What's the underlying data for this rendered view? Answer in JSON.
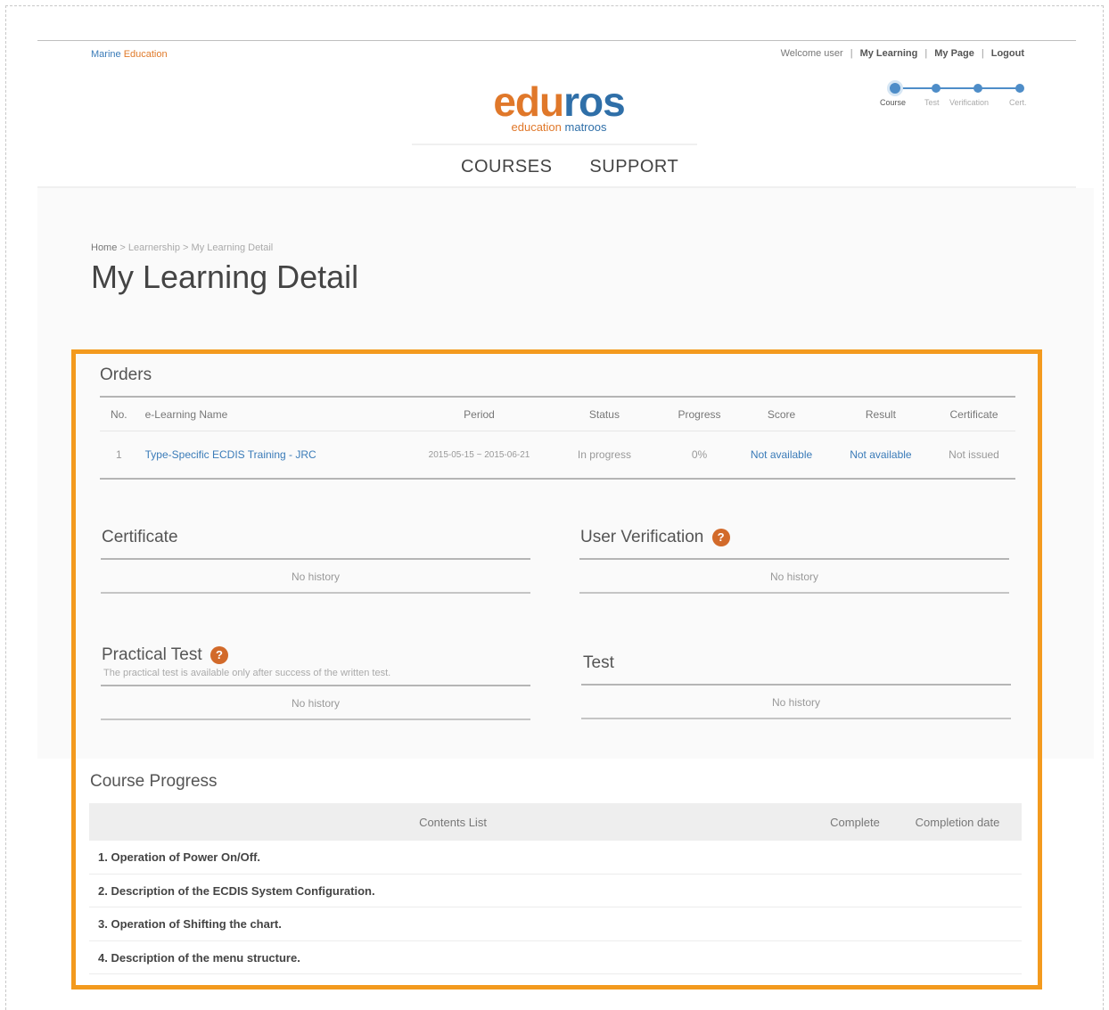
{
  "header": {
    "brand_link_part1": "Marine",
    "brand_link_part2": "Education",
    "topnav": {
      "welcome": "Welcome user",
      "my_learning": "My Learning",
      "my_page": "My Page",
      "logout": "Logout",
      "separator": "|"
    },
    "logo": {
      "main_part1": "edu",
      "main_part2": "ros",
      "sub_part1": "education",
      "sub_part2": "matroos"
    },
    "nav": {
      "courses": "COURSES",
      "support": "SUPPORT"
    },
    "steps": [
      "Course",
      "Test",
      "Verification",
      "Cert."
    ],
    "accent_orange": "#e0782a",
    "accent_blue": "#2f6fa8"
  },
  "breadcrumb": {
    "home": "Home",
    "sep1": " > ",
    "middle": "Learnership",
    "sep2": " > ",
    "current": "My Learning Detail"
  },
  "page_title": "My Learning Detail",
  "orders": {
    "title": "Orders",
    "columns": [
      "No.",
      "e-Learning Name",
      "Period",
      "Status",
      "Progress",
      "Score",
      "Result",
      "Certificate"
    ],
    "rows": [
      {
        "no": "1",
        "name": "Type-Specific ECDIS Training - JRC",
        "period": "2015-05-15 ~ 2015-06-21",
        "status": "In progress",
        "progress": "0%",
        "score": "Not available",
        "result": "Not available",
        "certificate": "Not issued"
      }
    ]
  },
  "certificate": {
    "title": "Certificate",
    "empty": "No history"
  },
  "user_verification": {
    "title": "User Verification",
    "help": "?",
    "empty": "No history"
  },
  "practical_test": {
    "title": "Practical Test",
    "help": "?",
    "note": "The practical test is available only after success of the written test.",
    "empty": "No history"
  },
  "test": {
    "title": "Test",
    "empty": "No history"
  },
  "course_progress": {
    "title": "Course Progress",
    "columns": [
      "Contents List",
      "Complete",
      "Completion date"
    ],
    "items": [
      "1. Operation of Power On/Off.",
      "2. Description of the ECDIS System Configuration.",
      "3. Operation of Shifting the chart.",
      "4. Description of the menu structure."
    ]
  },
  "highlight_color": "#f39a1e"
}
